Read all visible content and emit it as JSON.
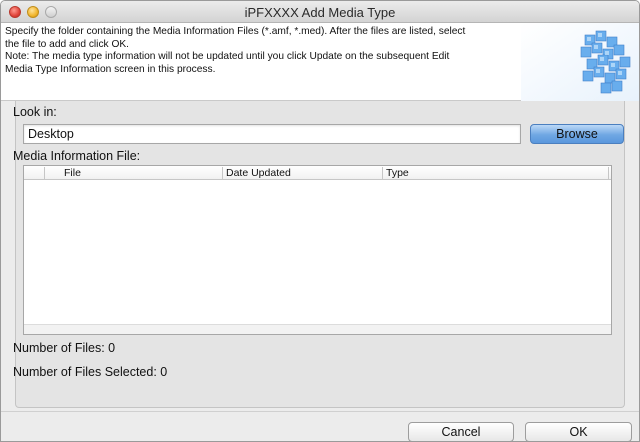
{
  "window": {
    "title": "iPFXXXX Add Media Type"
  },
  "header": {
    "line1": "Specify the folder containing the Media Information Files (*.amf, *.med). After the files are listed, select",
    "line2": "the file to add and click OK.",
    "line3": "Note: The media type information will not be updated until you click Update on the subsequent Edit",
    "line4": "Media Type Information screen in this process."
  },
  "lookin": {
    "label": "Look in:",
    "value": "Desktop",
    "browse_label": "Browse"
  },
  "media": {
    "label": "Media Information File:",
    "columns": [
      "File",
      "Date Updated",
      "Type"
    ],
    "rows": []
  },
  "stats": {
    "number_of_files": "Number of Files: 0",
    "number_selected": "Number of Files Selected: 0"
  },
  "footer": {
    "cancel_label": "Cancel",
    "ok_label": "OK"
  },
  "colors": {
    "accent_button": "#6fa7e3",
    "window_bg": "#ececec"
  }
}
